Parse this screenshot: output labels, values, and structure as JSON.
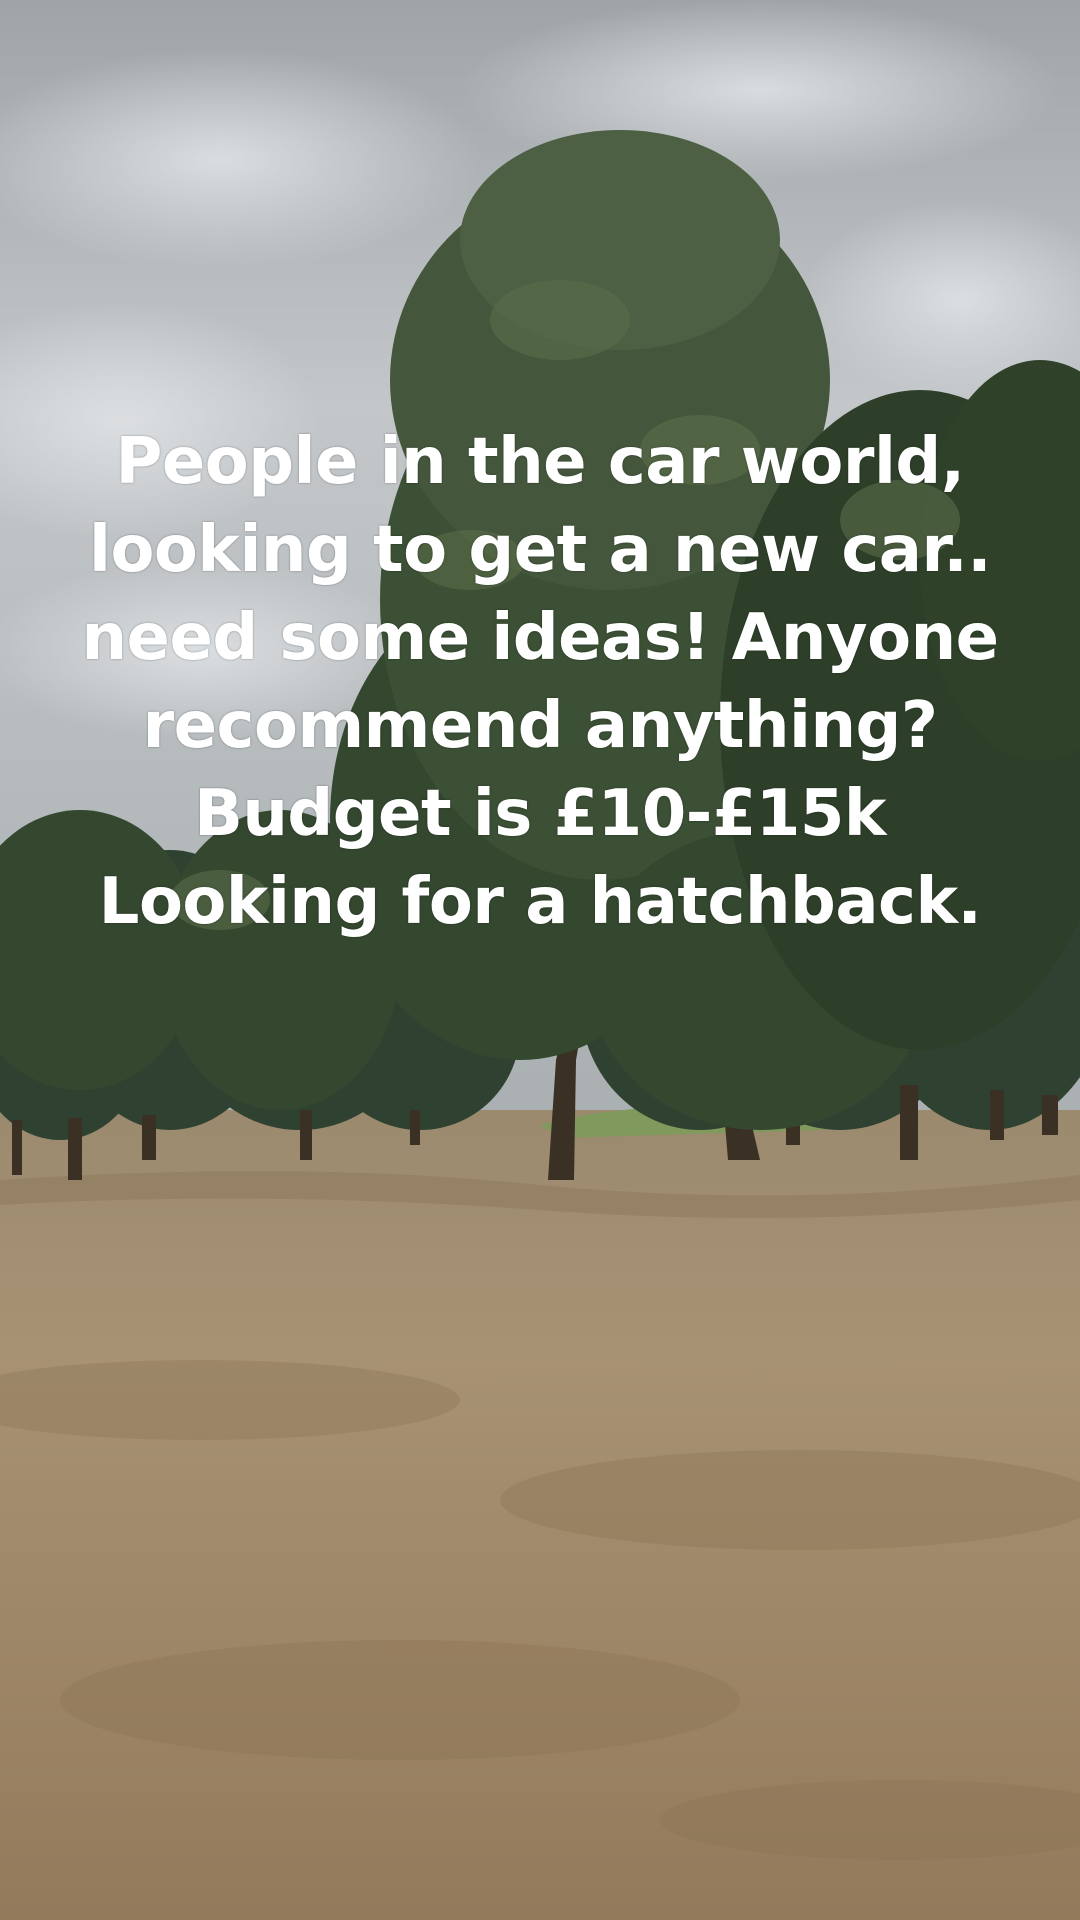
{
  "caption": {
    "lines": [
      "People in the car world,",
      "looking to get a new car..",
      "need some ideas! Anyone",
      "recommend anything?",
      "Budget is £10-£15k",
      "Looking for a hatchback."
    ]
  },
  "scene": {
    "subject": "park with trees and dry grass under overcast sky",
    "colors": {
      "sky": "#b9bec2",
      "foliage": "#34472f",
      "grass": "#a8916e",
      "text": "#ffffff"
    }
  }
}
